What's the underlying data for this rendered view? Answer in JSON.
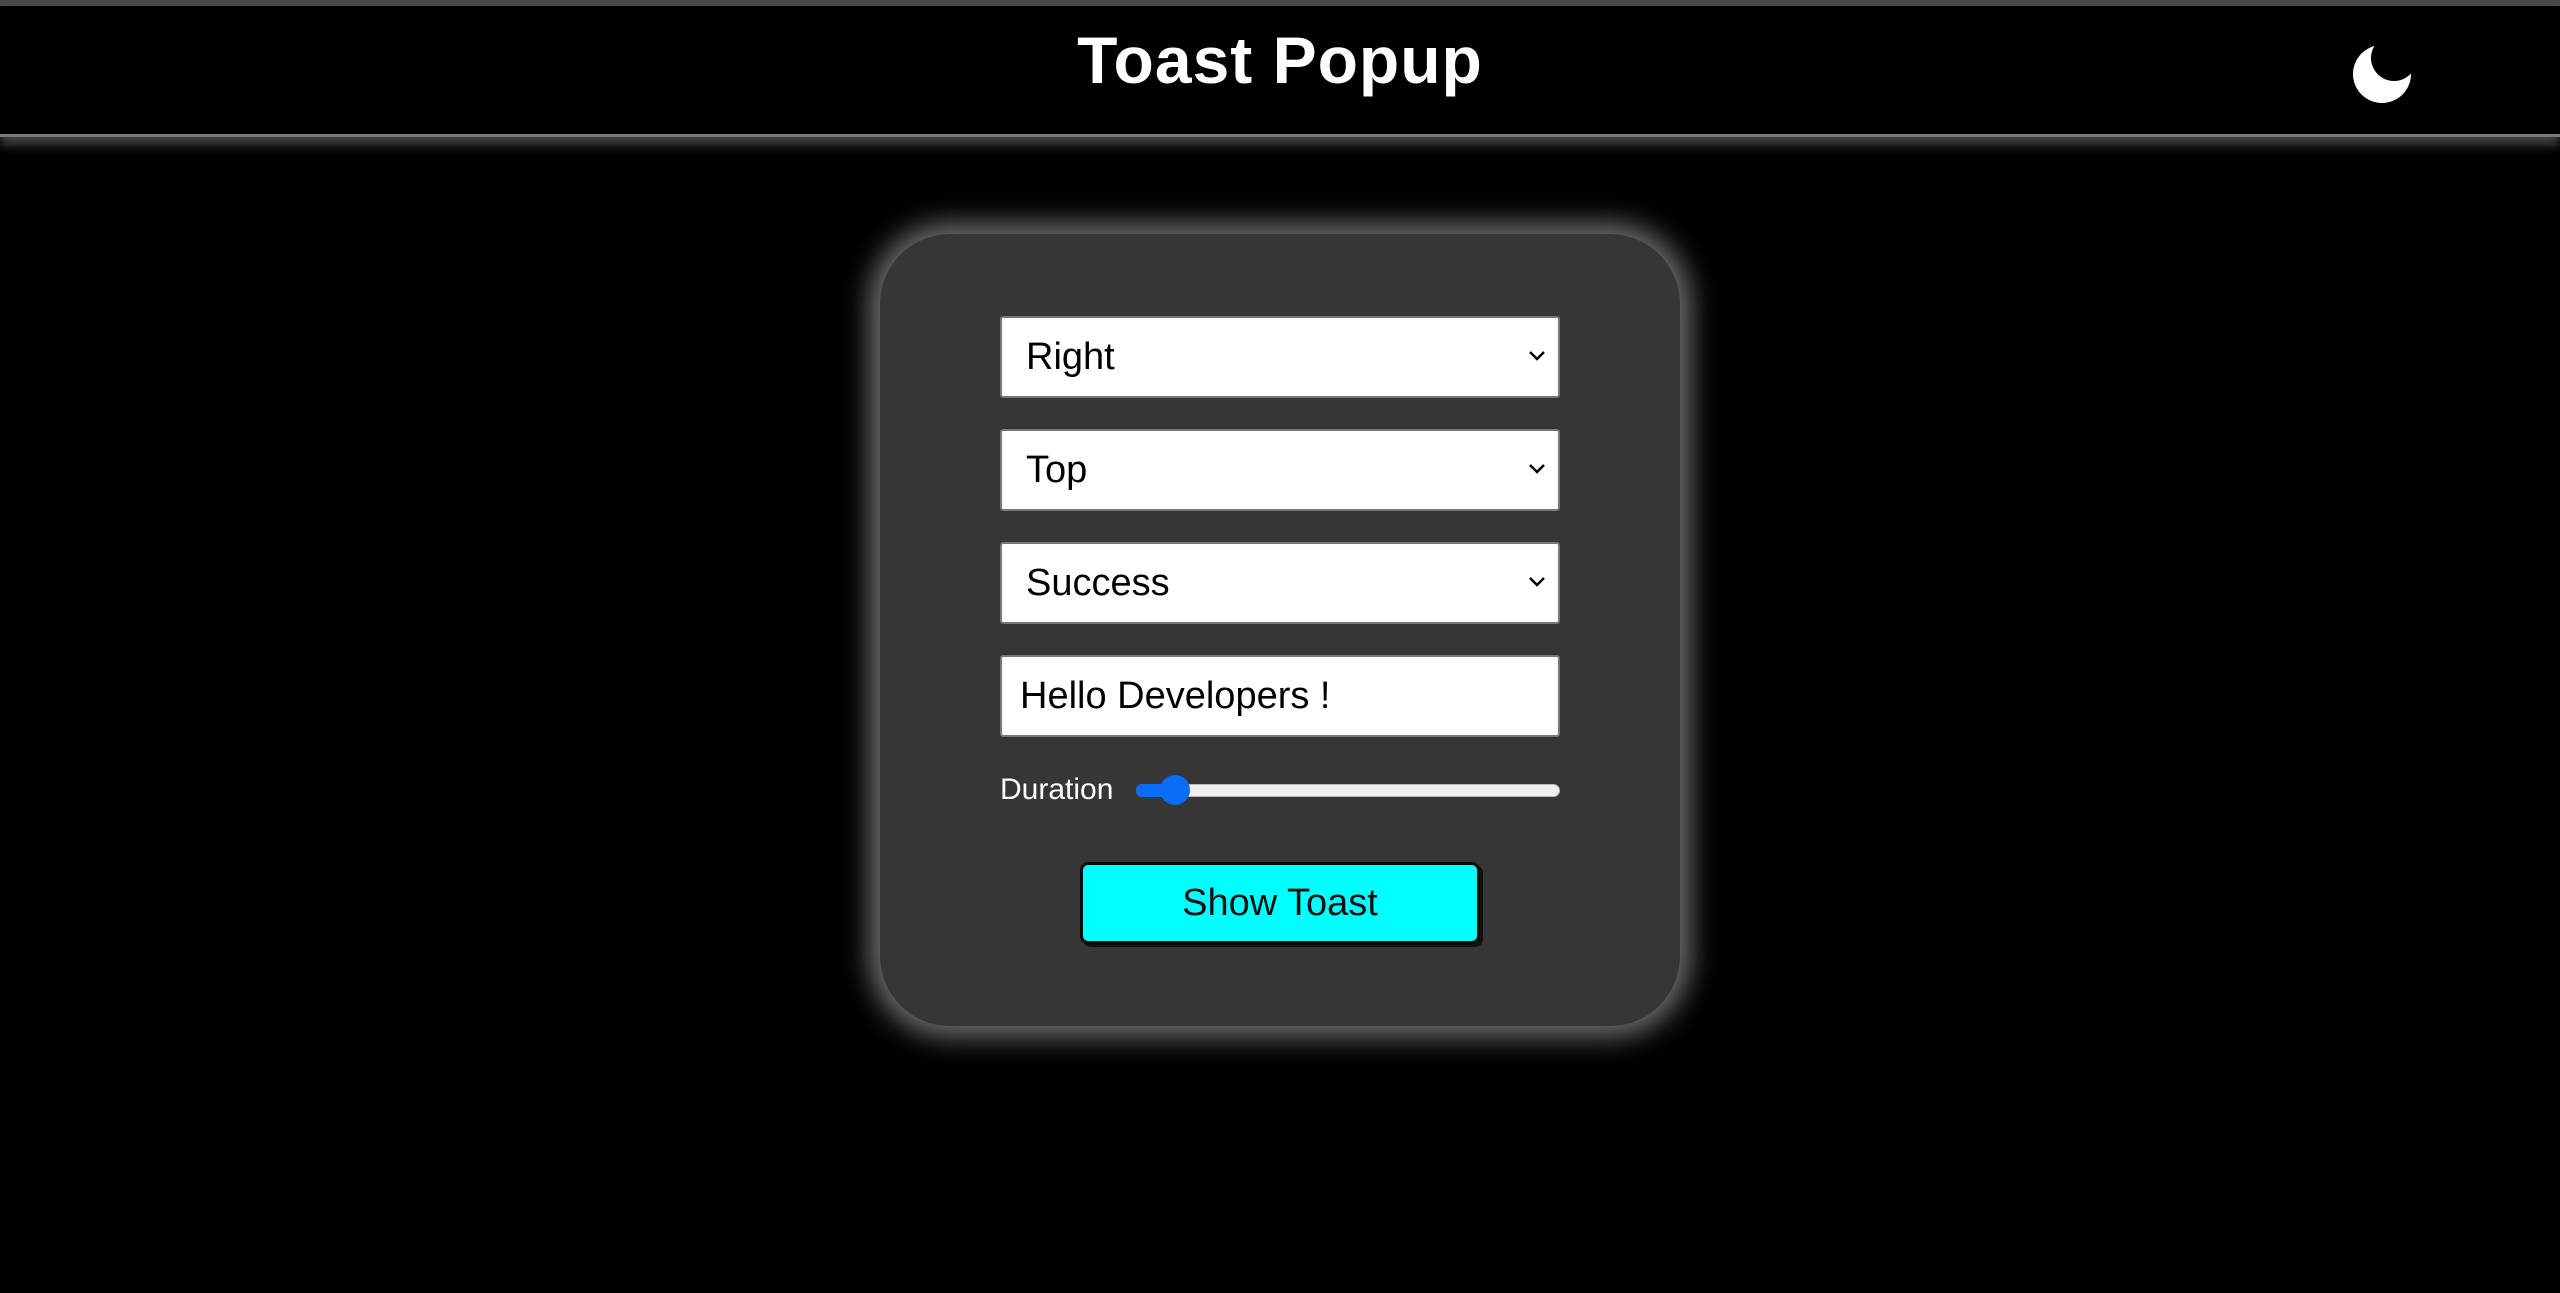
{
  "header": {
    "title": "Toast Popup",
    "theme_icon": "moon-icon"
  },
  "form": {
    "horizontal_position": {
      "selected": "Right"
    },
    "vertical_position": {
      "selected": "Top"
    },
    "toast_type": {
      "selected": "Success"
    },
    "message": {
      "value": "Hello Developers !"
    },
    "duration": {
      "label": "Duration",
      "level_fraction": 0.06
    },
    "show_button": {
      "label": "Show Toast"
    }
  },
  "colors": {
    "accent_button": "#00ffff",
    "slider": "#0b6cf5",
    "card": "#363636",
    "background": "#000000"
  }
}
